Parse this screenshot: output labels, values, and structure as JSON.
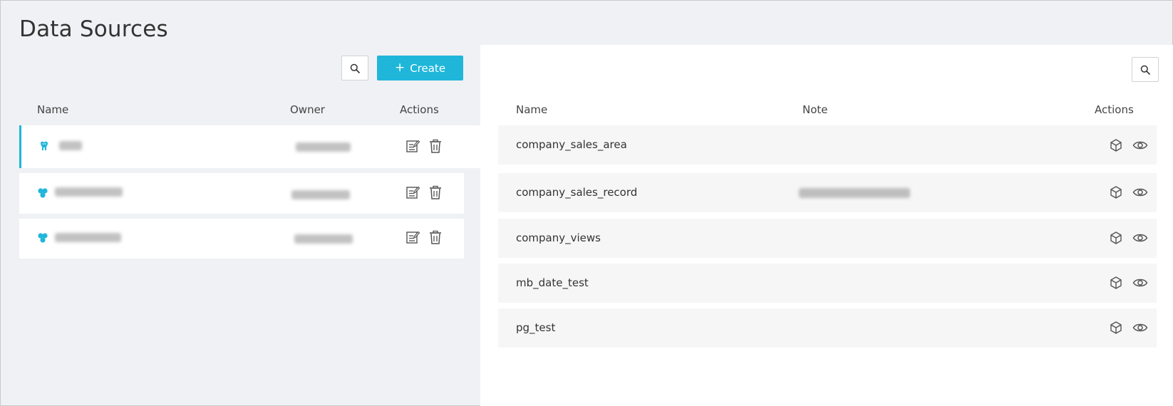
{
  "page": {
    "title": "Data Sources"
  },
  "left": {
    "create_label": "Create",
    "create_plus": "+",
    "columns": {
      "name": "Name",
      "owner": "Owner",
      "actions": "Actions"
    }
  },
  "right": {
    "columns": {
      "name": "Name",
      "note": "Note",
      "actions": "Actions"
    },
    "tables": [
      {
        "name": "company_sales_area"
      },
      {
        "name": "company_sales_record"
      },
      {
        "name": "company_views"
      },
      {
        "name": "mb_date_test"
      },
      {
        "name": "pg_test"
      }
    ]
  },
  "colors": {
    "accent": "#1fb6da",
    "page_bg": "#f0f1f4",
    "row_bg": "#f6f6f6"
  },
  "icons": [
    "search-icon",
    "postgres-icon",
    "cluster-icon",
    "edit-icon",
    "trash-icon",
    "cube-icon",
    "eye-icon"
  ]
}
